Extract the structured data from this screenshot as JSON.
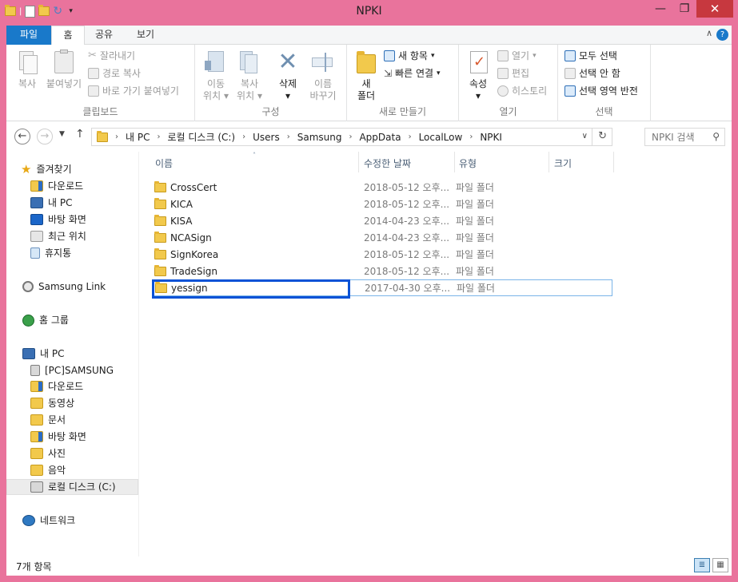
{
  "window": {
    "title": "NPKI",
    "minimize_glyph": "—",
    "restore_glyph": "❐",
    "close_glyph": "✕"
  },
  "ribbon_tabs": [
    "파일",
    "홈",
    "공유",
    "보기"
  ],
  "ribbon": {
    "clipboard": {
      "label": "클립보드",
      "copy": "복사",
      "paste": "붙여넣기",
      "cut": "잘라내기",
      "copy_path": "경로 복사",
      "paste_shortcut": "바로 가기 붙여넣기"
    },
    "organize": {
      "label": "구성",
      "move_to_1": "이동",
      "move_to_2": "위치",
      "copy_to_1": "복사",
      "copy_to_2": "위치",
      "delete": "삭제",
      "rename_1": "이름",
      "rename_2": "바꾸기"
    },
    "new": {
      "label": "새로 만들기",
      "new_folder_1": "새",
      "new_folder_2": "폴더",
      "new_item": "새 항목",
      "easy_access": "빠른 연결"
    },
    "open": {
      "label": "열기",
      "properties": "속성",
      "open": "열기",
      "edit": "편집",
      "history": "히스토리"
    },
    "select": {
      "label": "선택",
      "select_all": "모두 선택",
      "select_none": "선택 안 함",
      "invert": "선택 영역 반전"
    }
  },
  "address": {
    "crumbs": [
      "내 PC",
      "로컬 디스크 (C:)",
      "Users",
      "Samsung",
      "AppData",
      "LocalLow",
      "NPKI"
    ],
    "search_placeholder": "NPKI 검색"
  },
  "nav": {
    "favorites": "즐겨찾기",
    "fav_items": [
      "다운로드",
      "내 PC",
      "바탕 화면",
      "최근 위치",
      "휴지통"
    ],
    "samsung_link": "Samsung Link",
    "homegroup": "홈 그룹",
    "this_pc": "내 PC",
    "pc_items": [
      "[PC]SAMSUNG",
      "다운로드",
      "동영상",
      "문서",
      "바탕 화면",
      "사진",
      "음악",
      "로컬 디스크 (C:)"
    ],
    "network": "네트워크"
  },
  "columns": {
    "name": "이름",
    "date": "수정한 날짜",
    "type": "유형",
    "size": "크기"
  },
  "files": [
    {
      "name": "CrossCert",
      "date": "2018-05-12 오후...",
      "type": "파일 폴더"
    },
    {
      "name": "KICA",
      "date": "2018-05-12 오후...",
      "type": "파일 폴더"
    },
    {
      "name": "KISA",
      "date": "2014-04-23 오후...",
      "type": "파일 폴더"
    },
    {
      "name": "NCASign",
      "date": "2014-04-23 오후...",
      "type": "파일 폴더"
    },
    {
      "name": "SignKorea",
      "date": "2018-05-12 오후...",
      "type": "파일 폴더"
    },
    {
      "name": "TradeSign",
      "date": "2018-05-12 오후...",
      "type": "파일 폴더"
    },
    {
      "name": "yessign",
      "date": "2017-04-30 오후...",
      "type": "파일 폴더"
    }
  ],
  "status": {
    "count": "7개 항목"
  },
  "colors": {
    "window_frame": "#e9739c",
    "file_tab": "#1979ca",
    "highlight_box": "#0a52d6",
    "close_button": "#c7383f"
  }
}
